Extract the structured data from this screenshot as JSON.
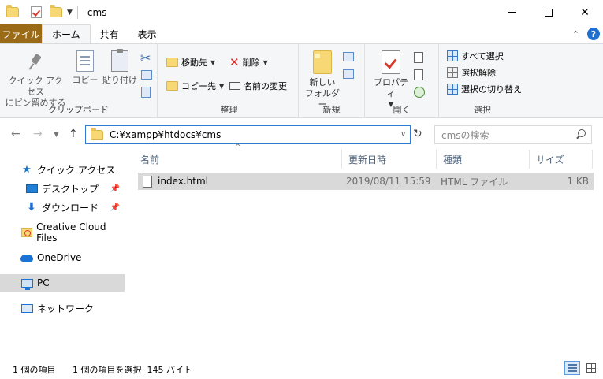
{
  "window": {
    "title": "cms"
  },
  "tabs": [
    {
      "label": "ファイル"
    },
    {
      "label": "ホーム"
    },
    {
      "label": "共有"
    },
    {
      "label": "表示"
    }
  ],
  "ribbon": {
    "clipboard": {
      "group_label": "クリップボード",
      "pin_label_1": "クイック アクセス",
      "pin_label_2": "にピン留めする",
      "copy_label": "コピー",
      "paste_label": "貼り付け"
    },
    "organize": {
      "group_label": "整理",
      "move_to": "移動先",
      "copy_to": "コピー先",
      "delete": "削除",
      "rename": "名前の変更"
    },
    "new": {
      "group_label": "新規",
      "new_folder_1": "新しい",
      "new_folder_2": "フォルダー"
    },
    "open": {
      "group_label": "開く",
      "properties": "プロパティ"
    },
    "select": {
      "group_label": "選択",
      "select_all": "すべて選択",
      "select_none": "選択解除",
      "invert": "選択の切り替え"
    }
  },
  "address": {
    "path": "C:¥xampp¥htdocs¥cms",
    "search_placeholder": "cmsの検索"
  },
  "nav_pane": {
    "quick_access": "クイック アクセス",
    "desktop": "デスクトップ",
    "downloads": "ダウンロード",
    "creative_cloud": "Creative Cloud Files",
    "onedrive": "OneDrive",
    "pc": "PC",
    "network": "ネットワーク"
  },
  "columns": {
    "name": "名前",
    "modified": "更新日時",
    "type": "種類",
    "size": "サイズ"
  },
  "files": [
    {
      "name": "index.html",
      "modified": "2019/08/11 15:59",
      "type": "HTML ファイル",
      "size": "1 KB"
    }
  ],
  "status": {
    "item_count": "1 個の項目",
    "selected": "1 個の項目を選択  145 バイト"
  }
}
